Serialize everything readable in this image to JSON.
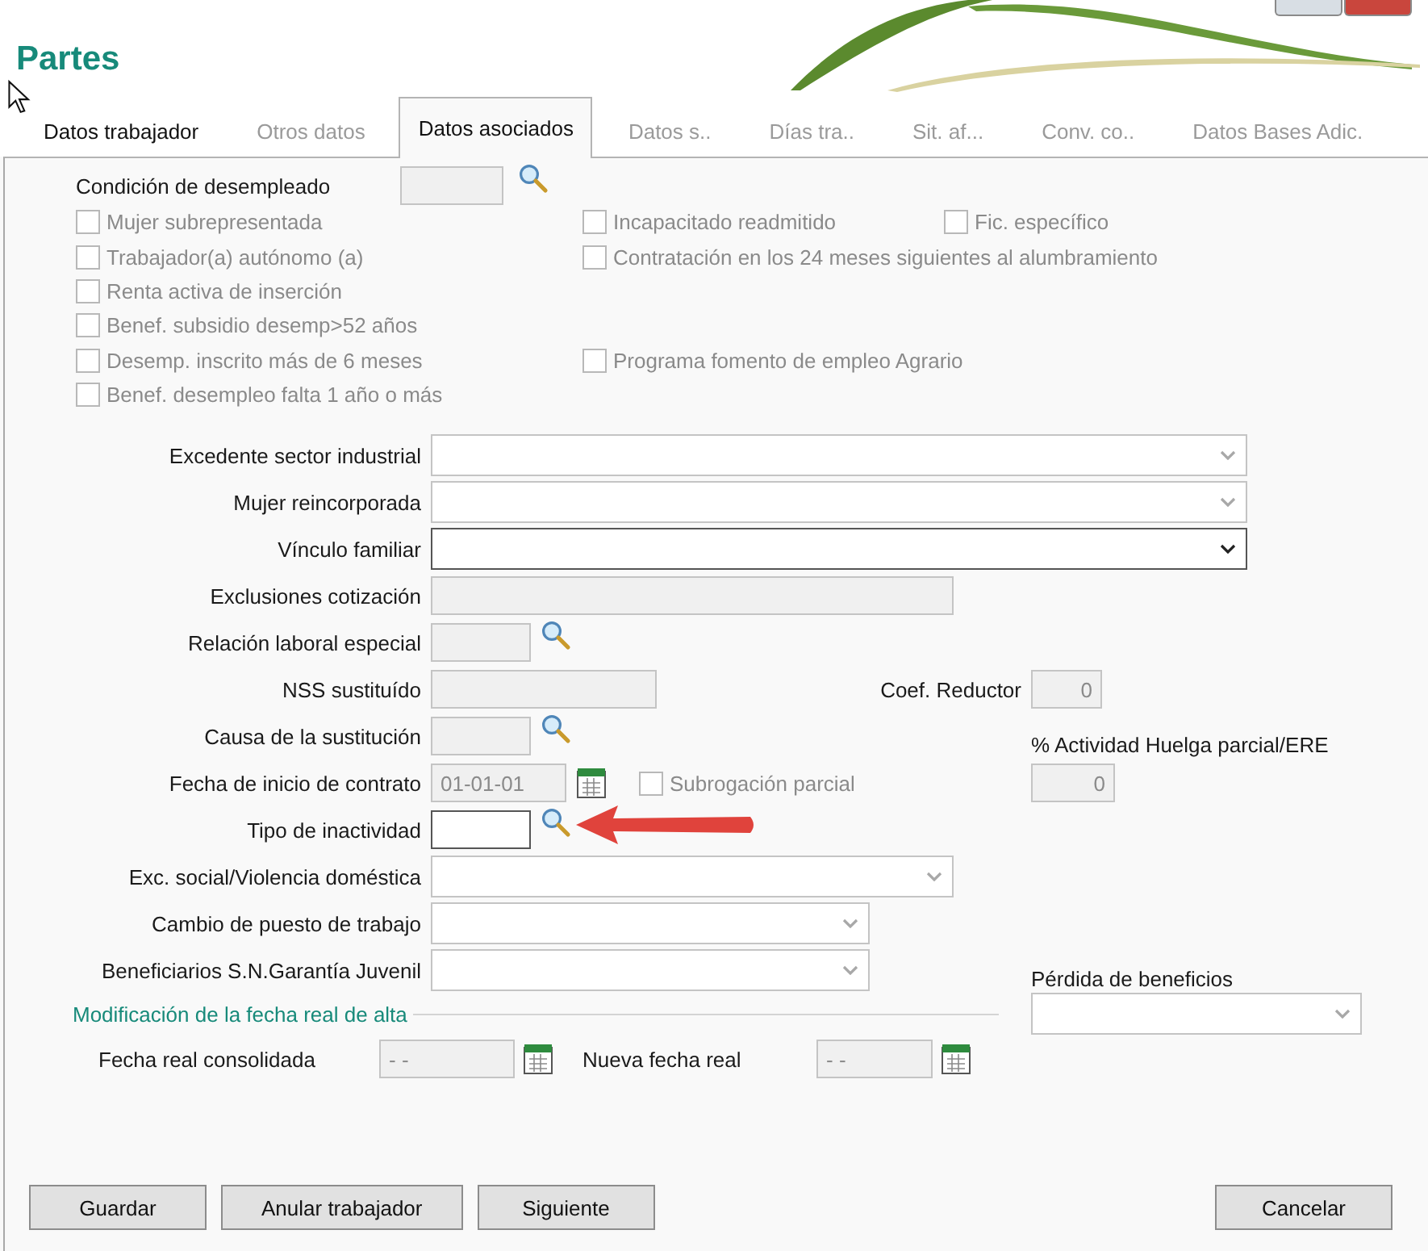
{
  "title": "Partes",
  "tabs": [
    {
      "label": "Datos trabajador",
      "selected": false,
      "disabled": false
    },
    {
      "label": "Otros datos",
      "selected": false,
      "disabled": true
    },
    {
      "label": "Datos asociados",
      "selected": true,
      "disabled": false
    },
    {
      "label": "Datos s..",
      "selected": false,
      "disabled": true
    },
    {
      "label": "Días tra..",
      "selected": false,
      "disabled": true
    },
    {
      "label": "Sit. af...",
      "selected": false,
      "disabled": true
    },
    {
      "label": "Conv. co..",
      "selected": false,
      "disabled": true
    },
    {
      "label": "Datos Bases Adic.",
      "selected": false,
      "disabled": true
    }
  ],
  "condicion": {
    "label": "Condición de desempleado",
    "disabled": true
  },
  "checkbox_rows": [
    {
      "left": {
        "label": "Mujer subrepresentada",
        "checked": false,
        "disabled": true
      },
      "right": [
        {
          "label": "Incapacitado readmitido",
          "checked": false,
          "disabled": true
        },
        {
          "label": "Fic. específico",
          "checked": false,
          "disabled": true
        }
      ]
    },
    {
      "left": {
        "label": "Trabajador(a) autónomo (a)",
        "checked": false,
        "disabled": true
      },
      "right": [
        {
          "label": "Contratación en los 24 meses siguientes al alumbramiento",
          "checked": false,
          "disabled": true
        }
      ]
    },
    {
      "left": {
        "label": "Renta activa de inserción",
        "checked": false,
        "disabled": true
      }
    },
    {
      "left": {
        "label": "Benef. subsidio desemp>52 años",
        "checked": false,
        "disabled": true
      }
    },
    {
      "left": {
        "label": "Desemp. inscrito más de 6 meses",
        "checked": false,
        "disabled": true
      },
      "right": [
        {
          "label": "Programa fomento de empleo Agrario",
          "checked": false,
          "disabled": true
        }
      ]
    },
    {
      "left": {
        "label": "Benef. desempleo falta 1 año o más",
        "checked": false,
        "disabled": true
      }
    }
  ],
  "fields": [
    {
      "label": "Excedente sector industrial",
      "kind": "combo",
      "disabled": true
    },
    {
      "label": "Mujer reincorporada",
      "kind": "combo",
      "disabled": true
    },
    {
      "label": "Vínculo familiar",
      "kind": "combo",
      "disabled": false
    },
    {
      "label": "Exclusiones cotización",
      "kind": "text",
      "disabled": true
    },
    {
      "label": "Relación laboral especial",
      "kind": "lookup",
      "disabled": true
    },
    {
      "label": "NSS sustituído",
      "kind": "text",
      "disabled": true
    },
    {
      "label": "Causa de la sustitución",
      "kind": "lookup",
      "disabled": true
    },
    {
      "label": "Fecha de inicio de contrato",
      "kind": "date",
      "value": "01-01-01",
      "disabled": true
    },
    {
      "label": "Tipo de inactividad",
      "kind": "lookup",
      "disabled": false
    },
    {
      "label": "Exc. social/Violencia doméstica",
      "kind": "combo",
      "disabled": true
    },
    {
      "label": "Cambio de puesto de trabajo",
      "kind": "combo",
      "disabled": true
    },
    {
      "label": "Beneficiarios S.N.Garantía Juvenil",
      "kind": "combo",
      "disabled": true
    }
  ],
  "coef_reductor": {
    "label": "Coef. Reductor",
    "value": "0"
  },
  "actividad_huelga": {
    "label": "% Actividad Huelga parcial/ERE",
    "value": "0"
  },
  "subrogacion": {
    "label": "Subrogación parcial",
    "checked": false,
    "disabled": true
  },
  "perdida_beneficios": {
    "label": "Pérdida de beneficios",
    "disabled": true
  },
  "modificacion": {
    "heading": "Modificación de la fecha real de alta",
    "fields": [
      {
        "label": "Fecha real consolidada",
        "value": "- -"
      },
      {
        "label": "Nueva fecha real",
        "value": "- -"
      }
    ]
  },
  "buttons": [
    {
      "label": "Guardar",
      "kind": "left"
    },
    {
      "label": "Anular trabajador",
      "kind": "left"
    },
    {
      "label": "Siguiente",
      "kind": "left"
    },
    {
      "label": "Cancelar",
      "kind": "right"
    }
  ]
}
